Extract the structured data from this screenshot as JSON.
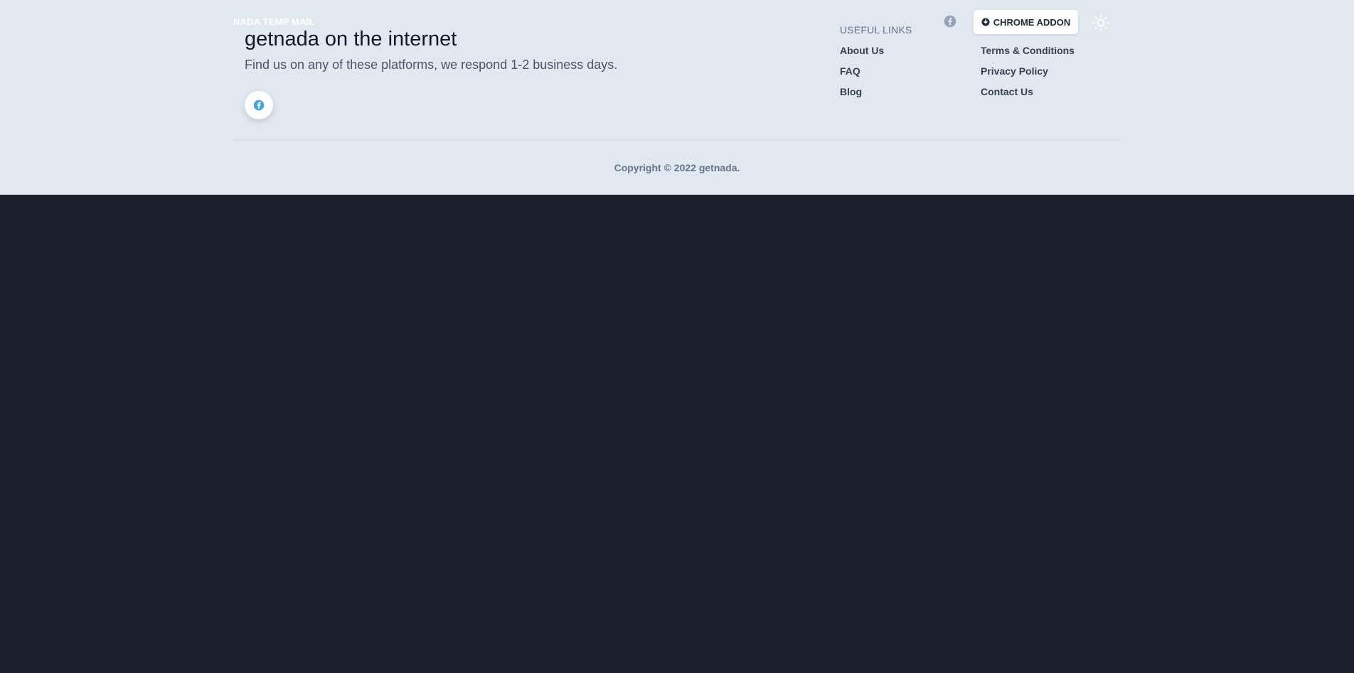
{
  "brand": "NADA TEMP MAIL",
  "hero": {
    "title": "getnada on the internet",
    "subtitle": "Find us on any of these platforms, we respond 1-2 business days.",
    "social_icon": "facebook-icon"
  },
  "links": {
    "title": "USEFUL LINKS",
    "left": [
      "About Us",
      "FAQ",
      "Blog"
    ],
    "right": [
      "Terms & Conditions",
      "Privacy Policy",
      "Contact Us"
    ]
  },
  "header": {
    "facebook_icon": "facebook-icon",
    "chrome_button": "CHROME ADDON",
    "theme_icon": "sun-icon"
  },
  "copyright": "Copyright © 2022 getnada.",
  "colors": {
    "footer_background": "#e1e8f0",
    "dark_background": "#1b1f2b",
    "facebook_blue": "#4aa3df",
    "muted_icon": "#94a3b8"
  }
}
